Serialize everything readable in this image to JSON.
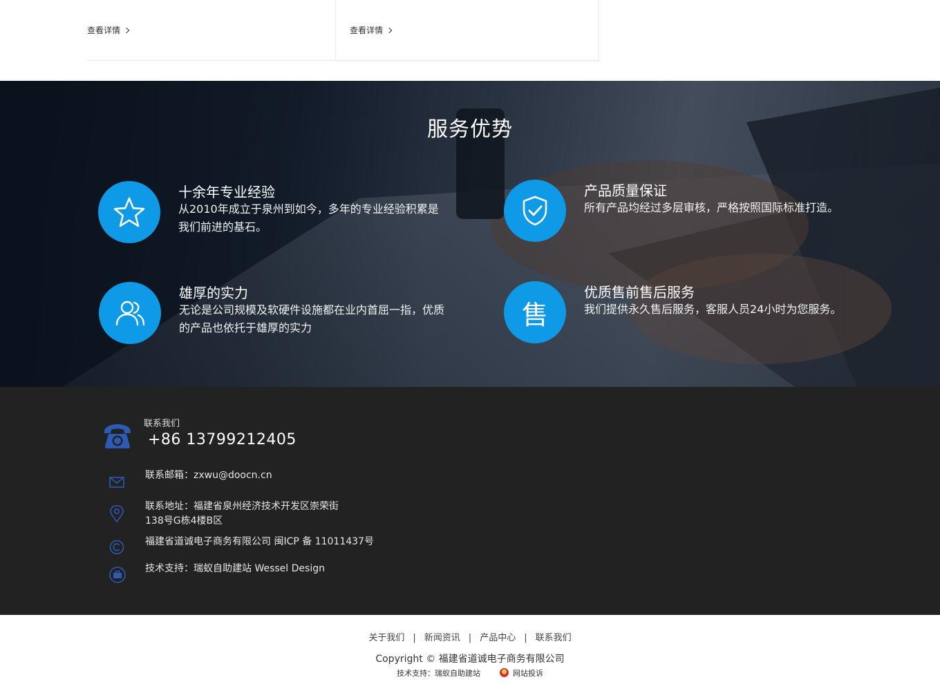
{
  "cards": [
    {
      "link_label": "查看详情"
    },
    {
      "link_label": "查看详情"
    }
  ],
  "hero": {
    "title": "服务优势",
    "features": [
      {
        "title": "十余年专业经验",
        "desc": "从2010年成立于泉州到如今，多年的专业经验积累是我们前进的基石。",
        "icon": "star-icon"
      },
      {
        "title": "产品质量保证",
        "desc": "所有产品均经过多层审核，严格按照国际标准打造。",
        "icon": "shield-check-icon"
      },
      {
        "title": "雄厚的实力",
        "desc": "无论是公司规模及软硬件设施都在业内首屈一指，优质的产品也依托于雄厚的实力",
        "icon": "users-icon"
      },
      {
        "title": "优质售前售后服务",
        "desc": "我们提供永久售后服务，客服人员24小时为您服务。",
        "icon": "sale-glyph-icon",
        "glyph": "售"
      }
    ]
  },
  "footer": {
    "contact_label": "联系我们",
    "phone": "+86 13799212405",
    "email": "联系邮箱：zxwu@doocn.cn",
    "address_line1": "联系地址：福建省泉州经济技术开发区崇荣街",
    "address_line2": "138号G栋4楼B区",
    "company_icp": "福建省道诚电子商务有限公司  闽ICP 备 11011437号",
    "tech_support": "技术支持：瑞蚁自助建站 Wessel Design",
    "icon_color": "#2b5bb5"
  },
  "bottom": {
    "nav": [
      {
        "label": "关于我们"
      },
      {
        "label": "新闻资讯"
      },
      {
        "label": "产品中心"
      },
      {
        "label": "联系我们"
      }
    ],
    "separator": "|",
    "copyright": "Copyright © 福建省道诚电子商务有限公司",
    "support": "技术支持：瑞蚁自助建站",
    "report": "网站投诉"
  },
  "colors": {
    "accent_blue": "#0e9ae6",
    "footer_bg": "#222222"
  }
}
